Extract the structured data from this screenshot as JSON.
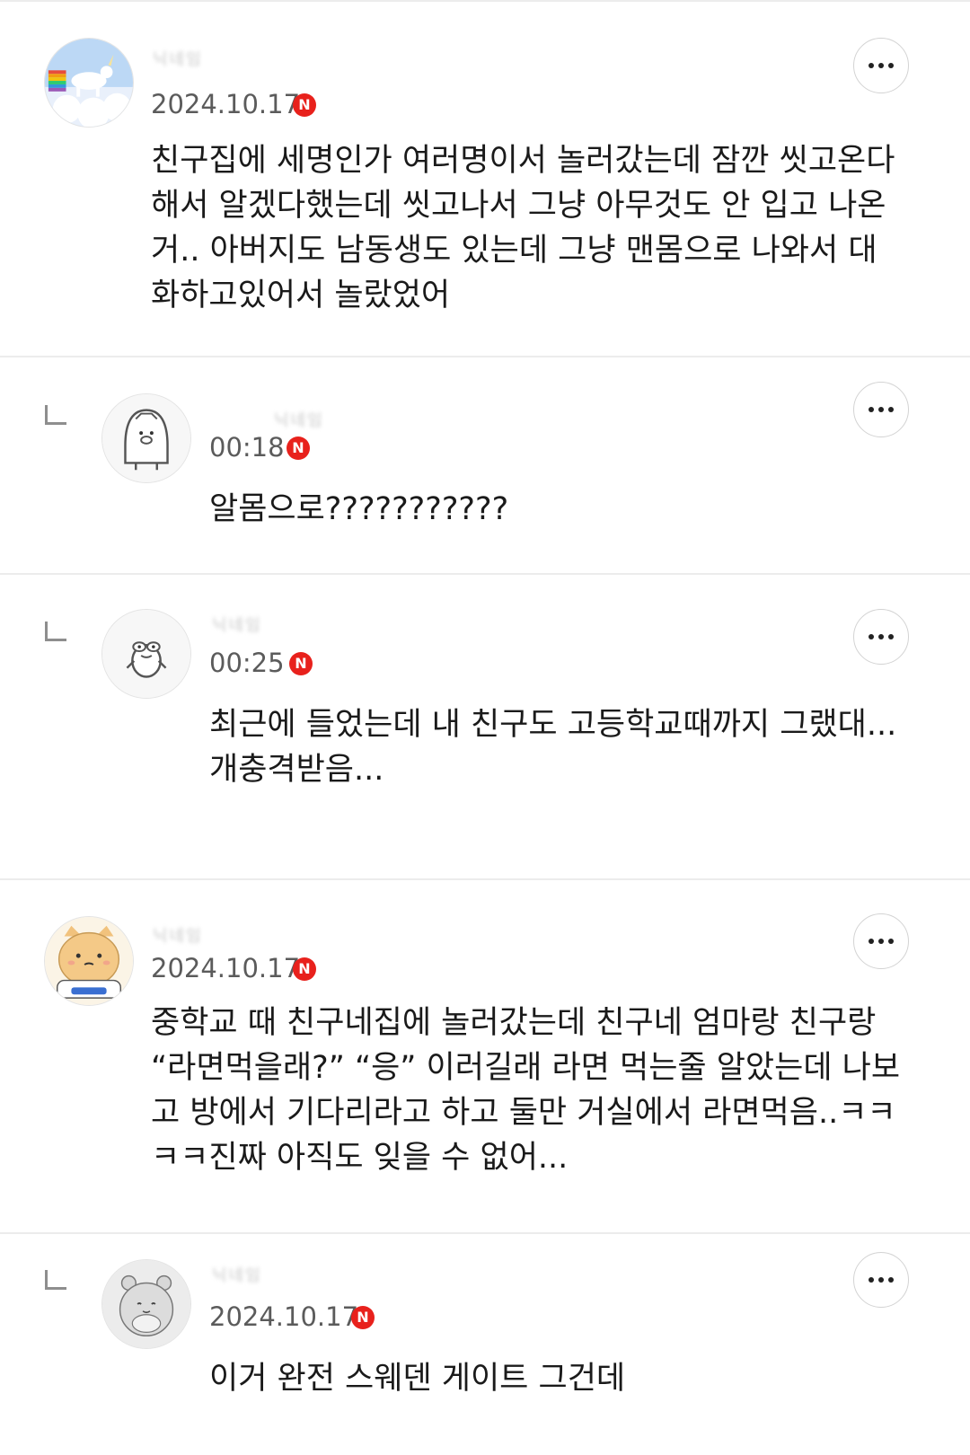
{
  "comments": [
    {
      "author": "닉네임",
      "date": "2024.10.17",
      "badge": "N",
      "avatar": "unicorn-rainbow-avatar",
      "is_reply": false,
      "lines": [
        "친구집에 세명인가 여러명이서 놀러갔는데 잠깐 씻고온다",
        "해서 알겠다했는데 씻고나서 그냥 아무것도 안 입고 나온",
        "거.. 아버지도 남동생도 있는데 그냥 맨몸으로 나와서 대",
        "화하고있어서 놀랐었어"
      ]
    },
    {
      "author": "닉네임",
      "date": "00:18",
      "badge": "N",
      "avatar": "penguin-avatar",
      "is_reply": true,
      "lines": [
        "알몸으로???????????"
      ]
    },
    {
      "author": "닉네임",
      "date": "00:25",
      "badge": "N",
      "avatar": "frog-character-avatar",
      "is_reply": true,
      "lines": [
        "최근에 들었는데 내 친구도 고등학교때까지 그랬대...",
        "개충격받음..."
      ]
    },
    {
      "author": "닉네임",
      "date": "2024.10.17",
      "badge": "N",
      "avatar": "cat-character-avatar",
      "is_reply": false,
      "lines": [
        "중학교 때 친구네집에 놀러갔는데 친구네 엄마랑 친구랑",
        "“라면먹을래?” “응” 이러길래 라면 먹는줄 알았는데 나보",
        "고 방에서 기다리라고 하고 둘만 거실에서 라면먹음..ㅋㅋ",
        "ㅋㅋ진짜 아직도 잊을 수 없어..."
      ]
    },
    {
      "author": "닉네임",
      "date": "2024.10.17",
      "badge": "N",
      "avatar": "hamster-avatar",
      "is_reply": true,
      "lines": [
        "이거 완전 스웨덴 게이트 그건데"
      ]
    }
  ],
  "colors": {
    "badge": "#e8211c",
    "divider": "#ececec",
    "meta": "#5b5b5b"
  }
}
